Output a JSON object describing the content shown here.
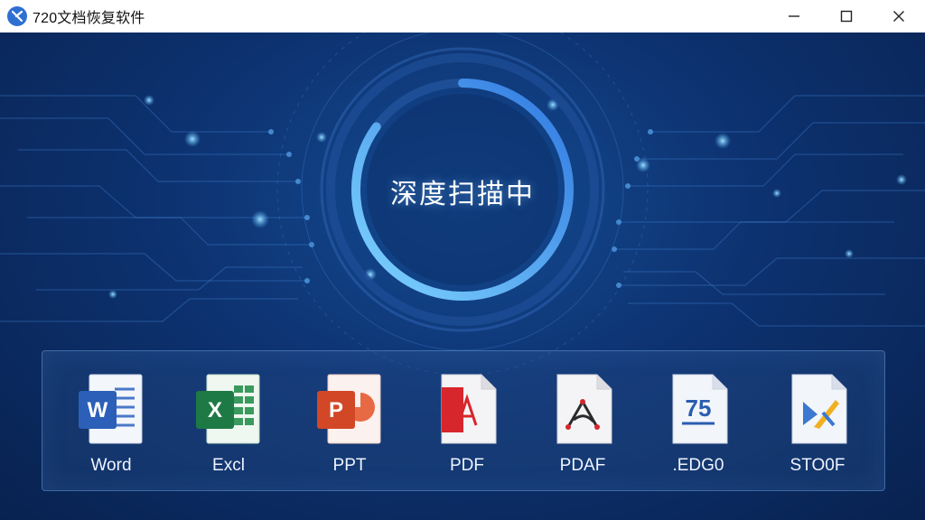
{
  "window": {
    "title": "720文档恢复软件"
  },
  "scan": {
    "status_text": "深度扫描中",
    "progress": 0.85
  },
  "file_types": [
    {
      "label": "Word",
      "icon": "word-icon",
      "badge": "W",
      "color": "#2b5fb8"
    },
    {
      "label": "Excl",
      "icon": "excel-icon",
      "badge": "X",
      "color": "#1e7a45"
    },
    {
      "label": "PPT",
      "icon": "ppt-icon",
      "badge": "P",
      "color": "#d24726"
    },
    {
      "label": "PDF",
      "icon": "pdf-icon",
      "badge": "",
      "color": "#d7262c"
    },
    {
      "label": "PDAF",
      "icon": "pdf-acrobat-icon",
      "badge": "",
      "color": "#d7262c"
    },
    {
      "label": ".EDG0",
      "icon": "edg-icon",
      "badge": "75",
      "color": "#2a5db0"
    },
    {
      "label": "STO0F",
      "icon": "sto-icon",
      "badge": "",
      "color": "#f0b020"
    }
  ],
  "colors": {
    "accent": "#4aa8f0",
    "background": "#0d3270"
  }
}
